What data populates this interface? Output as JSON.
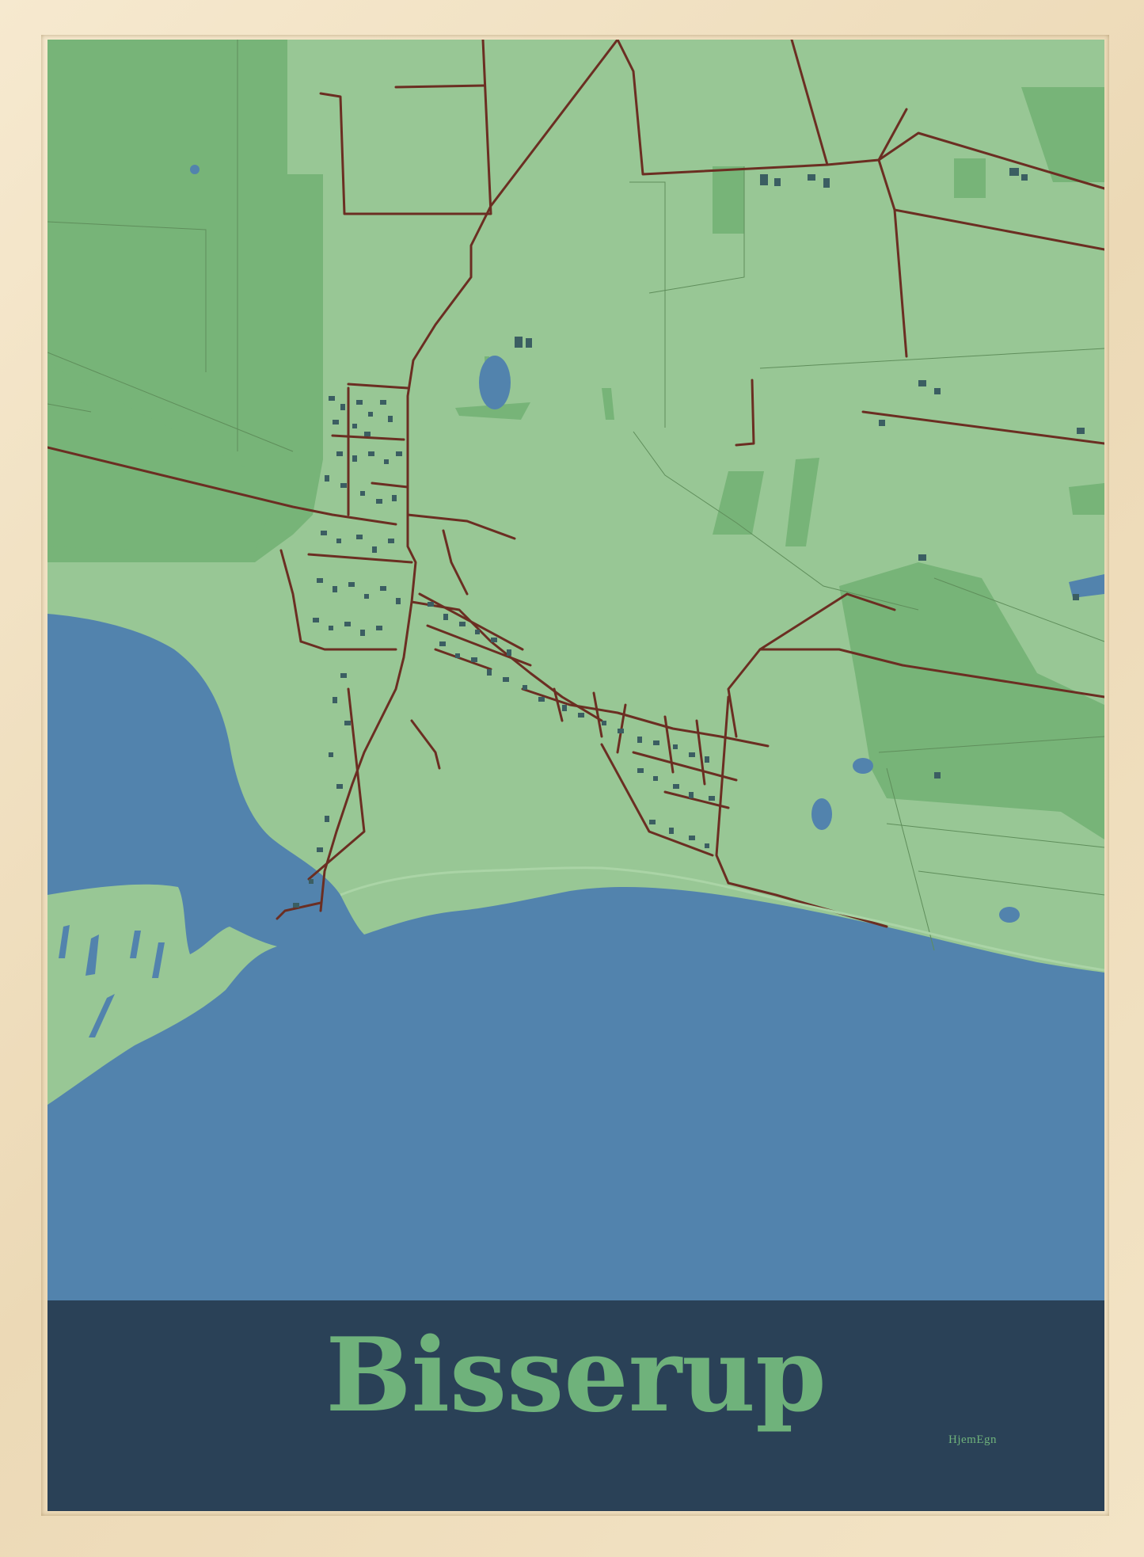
{
  "poster": {
    "title": "Bisserup",
    "brand": "HjemEgn"
  },
  "map_features": {
    "town": "Bisserup",
    "layers": [
      "water",
      "farmland",
      "woodland",
      "roads",
      "buildings"
    ]
  },
  "colors": {
    "frame": "#efe0c4",
    "farmland": "#98c795",
    "woodland": "#77b478",
    "water": "#5283ad",
    "roads": "#6b2e22",
    "buildings": "#3b5e62",
    "label_band": "#2a4157",
    "title_text": "#6fb27b"
  }
}
